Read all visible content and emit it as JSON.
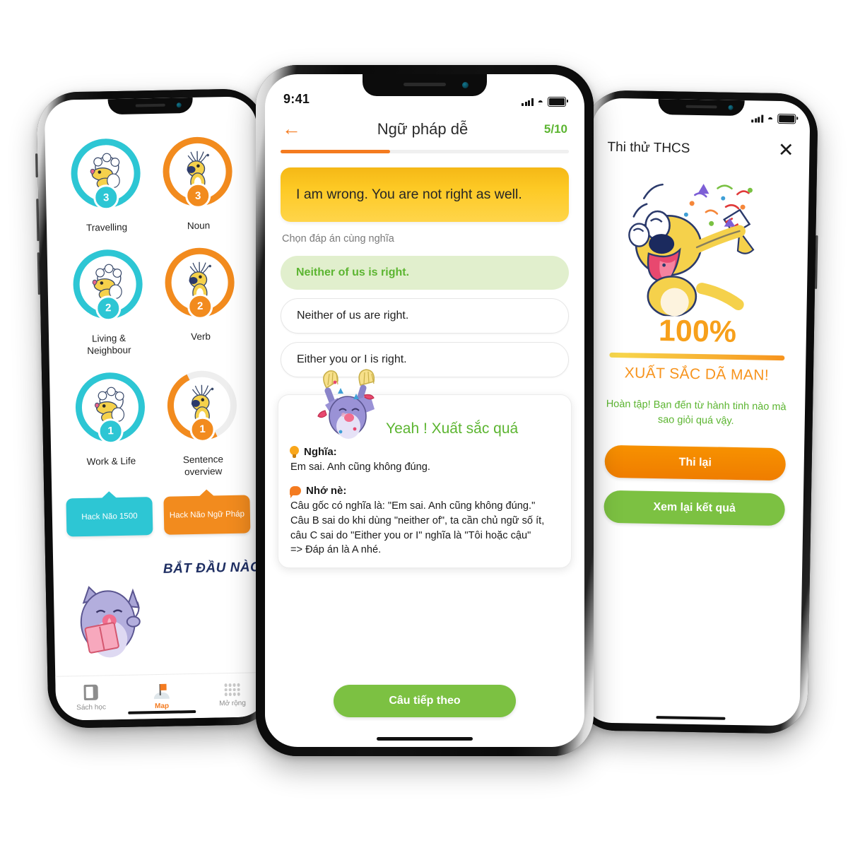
{
  "center_phone": {
    "status": {
      "time": "9:41",
      "signal_icon": "cellular-signal-icon",
      "wifi_icon": "wifi-icon",
      "battery_icon": "battery-icon"
    },
    "header": {
      "back_icon": "back-arrow-icon",
      "title": "Ngữ pháp dễ",
      "counter": "5/10",
      "progress_percent": 38
    },
    "prompt": "I am wrong. You are not right as well.",
    "instruction": "Chọn đáp án cùng nghĩa",
    "options": [
      {
        "text": "Neither of us is right.",
        "state": "correct"
      },
      {
        "text": "Neither of us are right.",
        "state": "default"
      },
      {
        "text": "Either you or I is right.",
        "state": "default"
      }
    ],
    "feedback": {
      "title": "Yeah ! Xuất sắc quá",
      "mascot_icon": "celebrating-cat-mascot-icon",
      "sections": [
        {
          "icon": "lightbulb-icon",
          "label": "Nghĩa:",
          "body": "Em sai. Anh cũng không đúng."
        },
        {
          "icon": "speech-bubble-icon",
          "label": "Nhớ nè:",
          "body": "Câu gốc có nghĩa là: \"Em sai. Anh cũng không đúng.\"\nCâu B sai do khi dùng \"neither of\", ta cần chủ ngữ số ít, câu C sai do \"Either you or I\" nghĩa là \"Tôi hoặc cậu\"\n=> Đáp án là A nhé."
        }
      ]
    },
    "next_button": "Câu tiếp theo"
  },
  "left_phone": {
    "nodes": [
      {
        "label": "Travelling",
        "count": "3",
        "color": "cyan",
        "ring": "full",
        "pet_icon": "sheep-mascot-icon"
      },
      {
        "label": "Noun",
        "count": "3",
        "color": "orange",
        "ring": "full",
        "pet_icon": "dog-mascot-icon"
      },
      {
        "label": "Living & Neighbour",
        "count": "2",
        "color": "cyan",
        "ring": "full",
        "pet_icon": "sheep-mascot-icon"
      },
      {
        "label": "Verb",
        "count": "2",
        "color": "orange",
        "ring": "full",
        "pet_icon": "dog-mascot-icon"
      },
      {
        "label": "Work & Life",
        "count": "1",
        "color": "cyan",
        "ring": "full",
        "pet_icon": "sheep-mascot-icon"
      },
      {
        "label": "Sentence overview",
        "count": "1",
        "color": "orange",
        "ring": "partial",
        "pet_icon": "dog-mascot-icon"
      }
    ],
    "pills": [
      {
        "label": "Hack Não 1500",
        "color": "cyan"
      },
      {
        "label": "Hack Não Ngữ Pháp",
        "color": "orange"
      }
    ],
    "start_banner": {
      "title": "BẮT ĐẦU NÀO",
      "mascot_icon": "reading-cat-mascot-icon"
    },
    "tabs": [
      {
        "label": "Sách học",
        "icon": "book-icon",
        "active": false
      },
      {
        "label": "Map",
        "icon": "map-flag-icon",
        "active": true
      },
      {
        "label": "Mở rộng",
        "icon": "grid-dots-icon",
        "active": false
      }
    ]
  },
  "right_phone": {
    "title": "Thi thử THCS",
    "close_icon": "close-icon",
    "mascot_icon": "party-dog-mascot-icon",
    "score": "100%",
    "score_percent": 100,
    "grade": "XUẤT SẮC DÃ MAN!",
    "message": "Hoàn tập! Bạn đến từ hành tinh nào mà sao giỏi quá vậy.",
    "buttons": [
      {
        "label": "Thi lại",
        "color": "orange"
      },
      {
        "label": "Xem lại kết quả",
        "color": "green"
      }
    ]
  },
  "colors": {
    "orange": "#f47b20",
    "green": "#7cc142",
    "cyan": "#2dc6d4",
    "yellow": "#fdc924",
    "correct_green": "#5cb531",
    "navy": "#1f2f63"
  }
}
